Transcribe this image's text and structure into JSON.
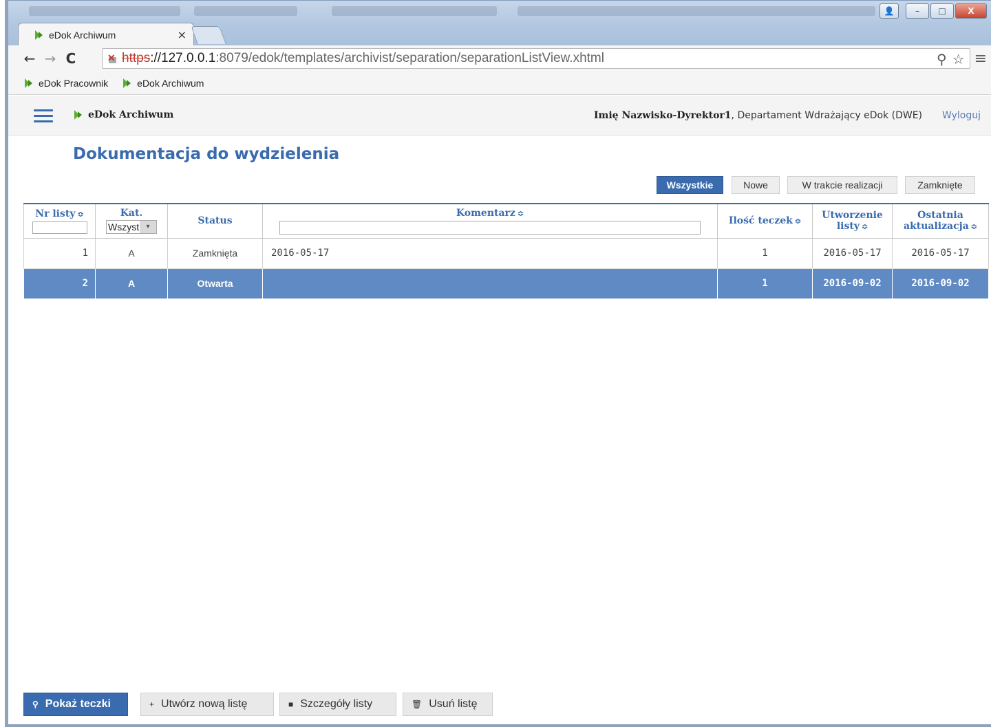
{
  "browser": {
    "tab_title": "eDok Archiwum",
    "tab_close": "×",
    "url_scheme": "https",
    "url_host": "://127.0.0.1",
    "url_path": ":8079/edok/templates/archivist/separation/separationListView.xhtml",
    "nav_back": "←",
    "nav_forward": "→",
    "nav_reload": "C",
    "zoom_icon": "⚲",
    "star_icon": "☆",
    "menu_icon": "≡",
    "window_buttons": {
      "user": "👤",
      "minimize": "–",
      "maximize": "□",
      "close": "X"
    }
  },
  "bookmarks": [
    {
      "label": "eDok Pracownik"
    },
    {
      "label": "eDok Archiwum"
    }
  ],
  "header": {
    "app_title": "eDok Archiwum",
    "user_name": "Imię Nazwisko-Dyrektor1",
    "user_dept": ", Departament Wdrażający eDok (DWE)",
    "logout": "Wyloguj"
  },
  "page": {
    "title": "Dokumentacja do wydzielenia"
  },
  "filters": [
    {
      "label": "Wszystkie",
      "active": true
    },
    {
      "label": "Nowe",
      "active": false
    },
    {
      "label": "W trakcie realizacji",
      "active": false
    },
    {
      "label": "Zamknięte",
      "active": false
    }
  ],
  "table": {
    "columns": {
      "nr": "Nr listy",
      "kat": "Kat.",
      "status": "Status",
      "komentarz": "Komentarz",
      "ilosc": "Ilość teczek",
      "utworzenie_1": "Utworzenie",
      "utworzenie_2": "listy",
      "aktualizacja_1": "Ostatnia",
      "aktualizacja_2": "aktualizacja"
    },
    "sort_icon": "≎",
    "kat_filter_value": "Wszystkie",
    "kat_filter_arrow": "▾",
    "rows": [
      {
        "nr": "1",
        "kat": "A",
        "status": "Zamknięta",
        "komentarz": "2016-05-17",
        "ilosc": "1",
        "utworzenie": "2016-05-17",
        "aktualizacja": "2016-05-17",
        "selected": false
      },
      {
        "nr": "2",
        "kat": "A",
        "status": "Otwarta",
        "komentarz": "",
        "ilosc": "1",
        "utworzenie": "2016-09-02",
        "aktualizacja": "2016-09-02",
        "selected": true
      }
    ]
  },
  "actions": [
    {
      "label": "Pokaż teczki",
      "icon": "⚲",
      "primary": true
    },
    {
      "label": "Utwórz nową listę",
      "icon": "+",
      "primary": false
    },
    {
      "label": "Szczegóły listy",
      "icon": "■",
      "primary": false
    },
    {
      "label": "Usuń listę",
      "icon": "🗑",
      "primary": false
    }
  ],
  "colors": {
    "accent": "#3a6bae",
    "selected_row": "#5f8ac4",
    "link": "#5a7db5"
  }
}
